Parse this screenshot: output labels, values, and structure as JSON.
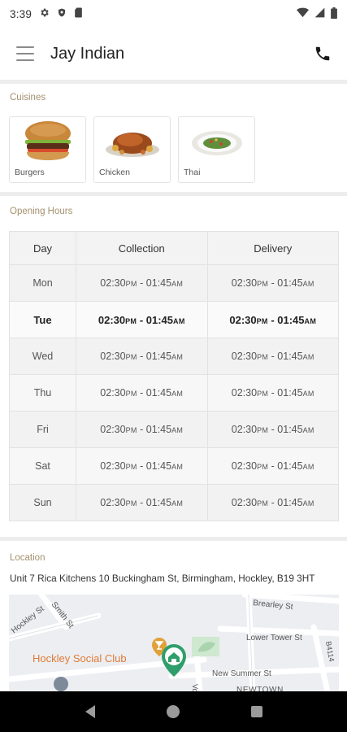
{
  "status_bar": {
    "time": "3:39",
    "left_icons": [
      "gear-icon",
      "shield-icon",
      "sim-icon"
    ],
    "right_icons": [
      "wifi-icon",
      "signal-icon",
      "battery-icon"
    ]
  },
  "app_bar": {
    "title": "Jay Indian",
    "menu_icon": "hamburger-menu-icon",
    "call_icon": "phone-icon"
  },
  "cuisines": {
    "heading": "Cuisines",
    "items": [
      {
        "label": "Burgers",
        "icon": "burger-image"
      },
      {
        "label": "Chicken",
        "icon": "roast-chicken-image"
      },
      {
        "label": "Thai",
        "icon": "thai-dish-image"
      }
    ]
  },
  "opening_hours": {
    "heading": "Opening Hours",
    "columns": [
      "Day",
      "Collection",
      "Delivery"
    ],
    "rows": [
      {
        "day": "Mon",
        "collection": [
          "02:30",
          "PM",
          " - 01:45",
          "AM"
        ],
        "delivery": [
          "02:30",
          "PM",
          " - 01:45",
          "AM"
        ],
        "today": false
      },
      {
        "day": "Tue",
        "collection": [
          "02:30",
          "PM",
          " - 01:45",
          "AM"
        ],
        "delivery": [
          "02:30",
          "PM",
          " - 01:45",
          "AM"
        ],
        "today": true
      },
      {
        "day": "Wed",
        "collection": [
          "02:30",
          "PM",
          " - 01:45",
          "AM"
        ],
        "delivery": [
          "02:30",
          "PM",
          " - 01:45",
          "AM"
        ],
        "today": false
      },
      {
        "day": "Thu",
        "collection": [
          "02:30",
          "PM",
          " - 01:45",
          "AM"
        ],
        "delivery": [
          "02:30",
          "PM",
          " - 01:45",
          "AM"
        ],
        "today": false
      },
      {
        "day": "Fri",
        "collection": [
          "02:30",
          "PM",
          " - 01:45",
          "AM"
        ],
        "delivery": [
          "02:30",
          "PM",
          " - 01:45",
          "AM"
        ],
        "today": false
      },
      {
        "day": "Sat",
        "collection": [
          "02:30",
          "PM",
          " - 01:45",
          "AM"
        ],
        "delivery": [
          "02:30",
          "PM",
          " - 01:45",
          "AM"
        ],
        "today": false
      },
      {
        "day": "Sun",
        "collection": [
          "02:30",
          "PM",
          " - 01:45",
          "AM"
        ],
        "delivery": [
          "02:30",
          "PM",
          " - 01:45",
          "AM"
        ],
        "today": false
      }
    ]
  },
  "location": {
    "heading": "Location",
    "address": "Unit 7 Rica Kitchens 10 Buckingham St, Birmingham, Hockley, B19 3HT",
    "map": {
      "labels": {
        "brearley": "Brearley St",
        "smith": "Smith St",
        "hockley": "Hockley St",
        "lower_tower": "Lower Tower St",
        "b4114": "B4114",
        "social_club": "Hockley Social Club",
        "new_summer": "New Summer St",
        "newtown": "NEWTOWN",
        "vo": "Vo"
      },
      "poi_color": "#e07b39",
      "pin_color": "#2e9e6a"
    }
  },
  "nav_bar": {
    "buttons": [
      "back-icon",
      "home-icon",
      "recents-icon"
    ]
  },
  "colors": {
    "section_label": "#a3906e",
    "divider": "#ededed"
  }
}
